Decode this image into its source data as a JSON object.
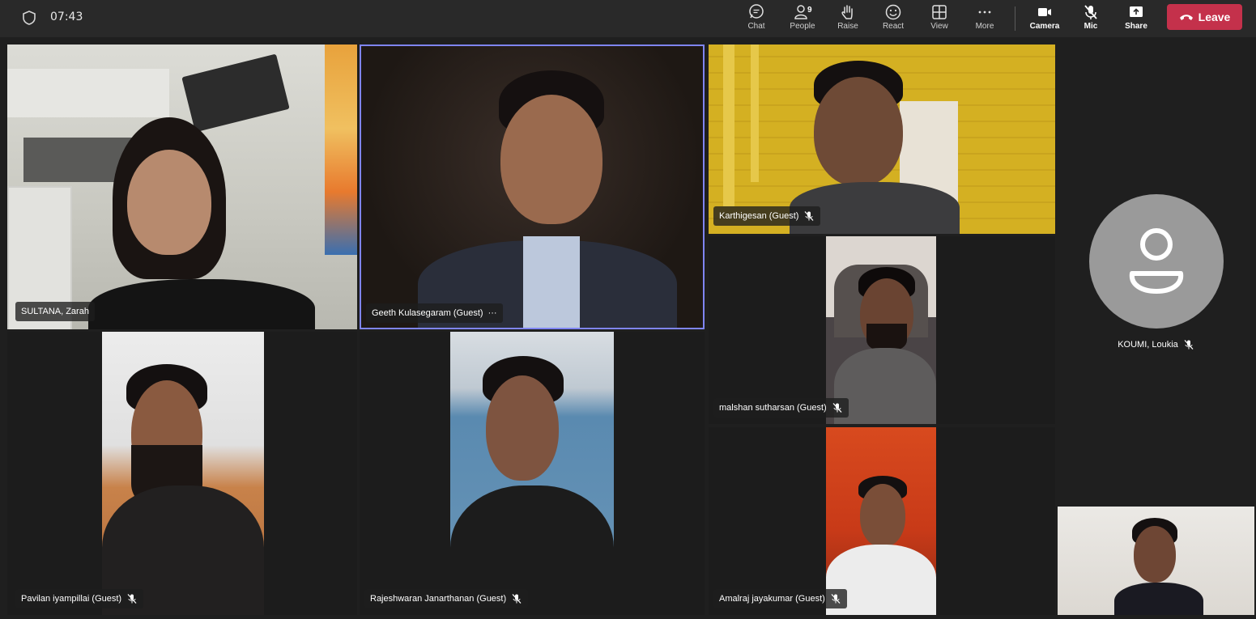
{
  "status": {
    "time": "07:43"
  },
  "toolbar": {
    "chat": "Chat",
    "people": "People",
    "people_count": "9",
    "raise": "Raise",
    "react": "React",
    "view": "View",
    "more": "More",
    "camera": "Camera",
    "mic": "Mic",
    "share": "Share",
    "leave": "Leave"
  },
  "participants": [
    {
      "name": "SULTANA, Zarah",
      "muted": false
    },
    {
      "name": "Geeth Kulasegaram (Guest)",
      "muted": false,
      "speaking": true,
      "menu": "···"
    },
    {
      "name": "Karthigesan (Guest)",
      "muted": true
    },
    {
      "name": "malshan sutharsan (Guest)",
      "muted": true
    },
    {
      "name": "Pavilan iyampillai (Guest)",
      "muted": true
    },
    {
      "name": "Rajeshwaran Janarthanan (Guest)",
      "muted": true
    },
    {
      "name": "Amalraj jayakumar (Guest)",
      "muted": true
    },
    {
      "name": "KOUMI, Loukia",
      "muted": true,
      "video": false
    }
  ],
  "colors": {
    "leave": "#c4314b",
    "active_border": "#7f85f5",
    "avatar_bg": "#9a9a9a"
  }
}
